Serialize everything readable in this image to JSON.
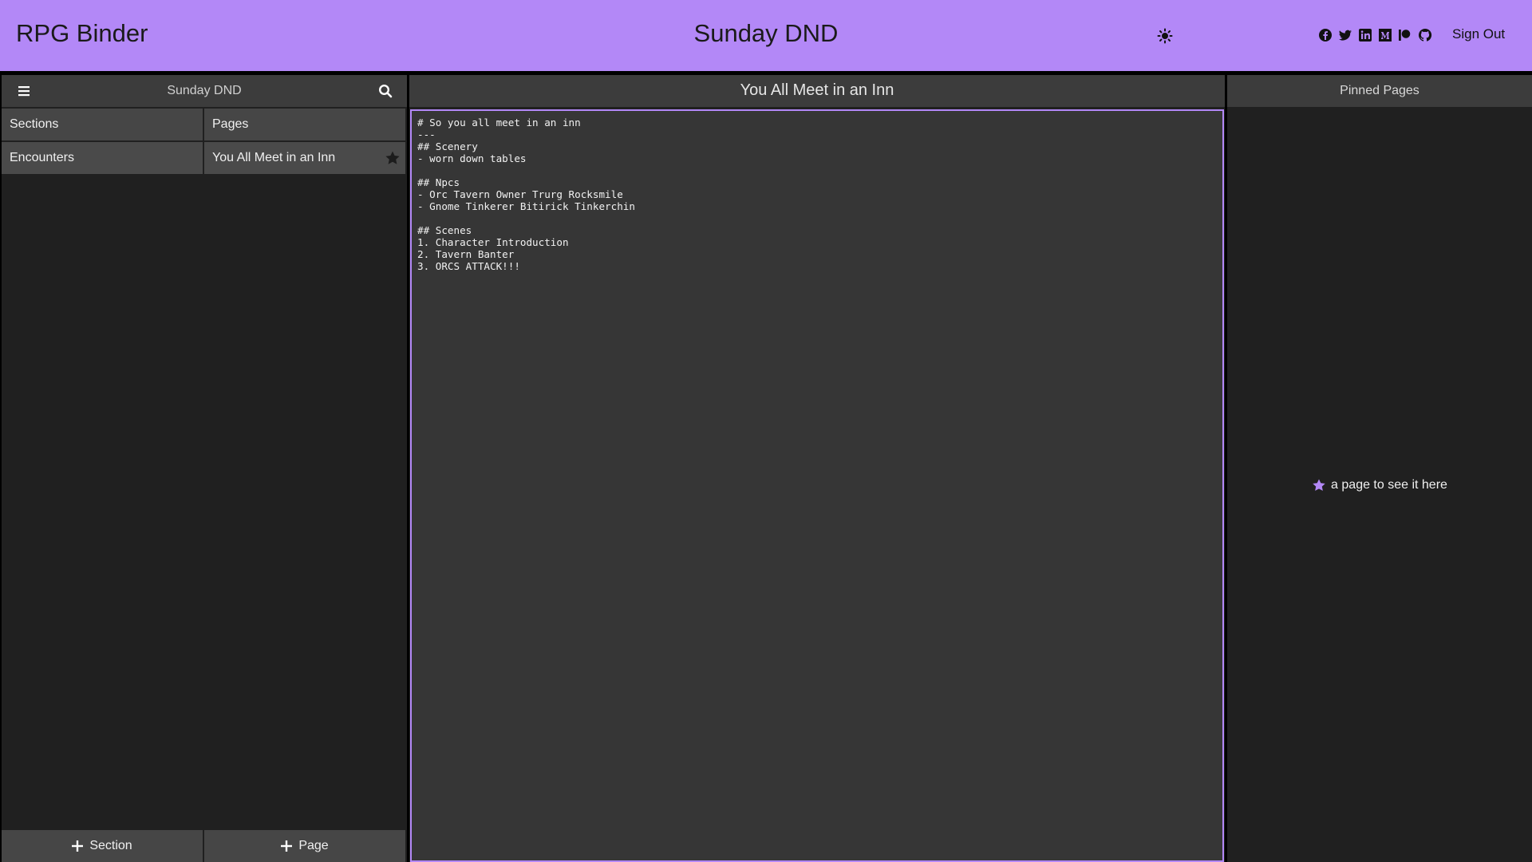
{
  "header": {
    "app_title": "RPG Binder",
    "campaign_title": "Sunday DND",
    "sign_out_label": "Sign Out",
    "theme_icon": "sun-icon",
    "social_icons": [
      "facebook-icon",
      "twitter-icon",
      "linkedin-icon",
      "medium-icon",
      "patreon-icon",
      "github-icon"
    ],
    "background_color": "#b388f7"
  },
  "left_panel": {
    "title": "Sunday DND",
    "sections_header": "Sections",
    "pages_header": "Pages",
    "sections": [
      {
        "label": "Encounters"
      }
    ],
    "pages": [
      {
        "label": "You All Meet in an Inn",
        "pinned": false
      }
    ],
    "add_section_label": "Section",
    "add_page_label": "Page"
  },
  "editor": {
    "page_title": "You All Meet in an Inn",
    "content": "# So you all meet in an inn\n---\n## Scenery\n- worn down tables\n\n## Npcs\n- Orc Tavern Owner Trurg Rocksmile\n- Gnome Tinkerer Bitirick Tinkerchin\n\n## Scenes\n1. Character Introduction\n2. Tavern Banter\n3. ORCS ATTACK!!!\n",
    "border_color": "#b388f7"
  },
  "pinned": {
    "title": "Pinned Pages",
    "empty_message": "a page to see it here",
    "star_color": "#b388f7"
  }
}
